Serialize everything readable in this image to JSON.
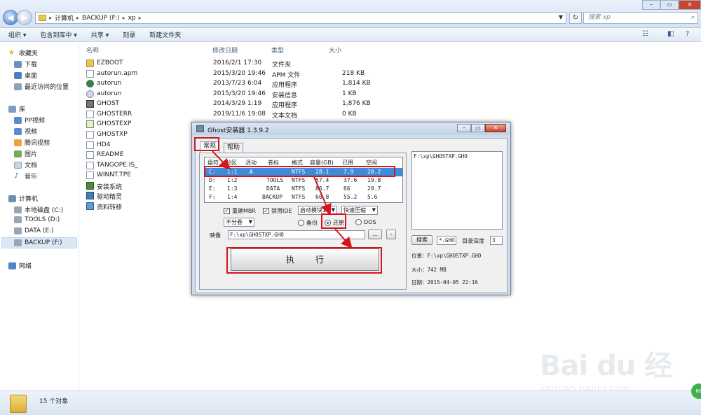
{
  "address": {
    "crumbs": [
      "计算机",
      "BACKUP (F:)",
      "xp"
    ],
    "search_placeholder": "搜索 xp"
  },
  "toolbar": {
    "organize": "组织 ▾",
    "include_library": "包含到库中 ▾",
    "share": "共享 ▾",
    "burn": "刻录",
    "new_folder": "新建文件夹"
  },
  "sidebar": {
    "favorites": "收藏夹",
    "downloads": "下载",
    "desktop": "桌面",
    "recent": "最近访问的位置",
    "library": "库",
    "pp_video": "PP视频",
    "video": "视频",
    "tencent_video": "腾讯视频",
    "pictures": "图片",
    "documents": "文档",
    "music": "音乐",
    "computer": "计算机",
    "drive_c": "本地磁盘 (C:)",
    "drive_d": "TOOLS (D:)",
    "drive_e": "DATA (E:)",
    "drive_f": "BACKUP (F:)",
    "network": "网络"
  },
  "columns": {
    "name": "名称",
    "date": "修改日期",
    "type": "类型",
    "size": "大小"
  },
  "files": [
    {
      "name": "EZBOOT",
      "date": "2016/2/1 17:30",
      "type": "文件夹",
      "size": "",
      "icon": "folder-icon"
    },
    {
      "name": "autorun.apm",
      "date": "2015/3/20 19:46",
      "type": "APM 文件",
      "size": "218 KB",
      "icon": "file-icon"
    },
    {
      "name": "autorun",
      "date": "2013/7/23 6:04",
      "type": "应用程序",
      "size": "1,814 KB",
      "icon": "app-icon"
    },
    {
      "name": "autorun",
      "date": "2015/3/20 19:46",
      "type": "安装信息",
      "size": "1 KB",
      "icon": "setup-info-icon"
    },
    {
      "name": "GHOST",
      "date": "2014/3/29 1:19",
      "type": "应用程序",
      "size": "1,876 KB",
      "icon": "ghost-icon"
    },
    {
      "name": "GHOSTERR",
      "date": "2019/11/6 19:08",
      "type": "文本文档",
      "size": "0 KB",
      "icon": "text-file-icon"
    },
    {
      "name": "GHOSTEXP",
      "date": "",
      "type": "",
      "size": "",
      "icon": "ghost-icon"
    },
    {
      "name": "GHOSTXP",
      "date": "",
      "type": "",
      "size": "",
      "icon": "file-icon"
    },
    {
      "name": "HD4",
      "date": "",
      "type": "",
      "size": "",
      "icon": "file-icon"
    },
    {
      "name": "README",
      "date": "",
      "type": "",
      "size": "",
      "icon": "file-icon"
    },
    {
      "name": "TANGOPE.IS_",
      "date": "",
      "type": "",
      "size": "",
      "icon": "file-icon"
    },
    {
      "name": "WINNT.TPE",
      "date": "",
      "type": "",
      "size": "",
      "icon": "file-icon"
    },
    {
      "name": "安装系统",
      "date": "",
      "type": "",
      "size": "",
      "icon": "installer-icon"
    },
    {
      "name": "驱动精灵",
      "date": "",
      "type": "",
      "size": "",
      "icon": "driver-icon"
    },
    {
      "name": "资料转移",
      "date": "",
      "type": "",
      "size": "",
      "icon": "transfer-icon"
    }
  ],
  "status": {
    "count": "15 个对象"
  },
  "watermark": {
    "logo": "Bai du 经验",
    "url": "jingyan.baidu.com"
  },
  "badge": "68",
  "dialog": {
    "title": "Ghost安装器 1.3.9.2",
    "tab_general": "常规",
    "tab_help": "帮助",
    "table_headers": [
      "盘符",
      "分区",
      "活动",
      "卷标",
      "格式",
      "容量(GB)",
      "已用",
      "空闲"
    ],
    "partitions": [
      {
        "drive": "C:",
        "part": "1:1",
        "active": "A",
        "label": "",
        "fs": "NTFS",
        "cap": "28.1",
        "used": "7.9",
        "free": "20.2"
      },
      {
        "drive": "D:",
        "part": "1:2",
        "active": "",
        "label": "TOOLS",
        "fs": "NTFS",
        "cap": "57.4",
        "used": "37.6",
        "free": "19.8"
      },
      {
        "drive": "E:",
        "part": "1:3",
        "active": "",
        "label": "DATA",
        "fs": "NTFS",
        "cap": "86.7",
        "used": "66",
        "free": "20.7"
      },
      {
        "drive": "F:",
        "part": "1:4",
        "active": "",
        "label": "BACKUP",
        "fs": "NTFS",
        "cap": "60.8",
        "used": "55.2",
        "free": "5.6"
      }
    ],
    "rebuild_mbr": "重建MBR",
    "disable_ide": "禁用IDE",
    "boot_module": "启动模块1",
    "compression": "快速压缩",
    "split": "不分卷",
    "backup": "备份",
    "restore": "还原",
    "dos": "DOS",
    "image_label": "映像",
    "image_path": "F:\\xp\\GHOSTXP.GHO",
    "browse": "...",
    "minus": "-",
    "execute": "执行",
    "list_item": "F:\\xp\\GHOSTXP.GHO",
    "search_btn": "搜索",
    "ext": "*.GHO",
    "depth_label": "目录深度",
    "depth": "3",
    "location": "位置：F:\\xp\\GHOSTXP.GHO",
    "size": "大小：742 MB",
    "date": "日期：2015-04-05  22:16"
  }
}
